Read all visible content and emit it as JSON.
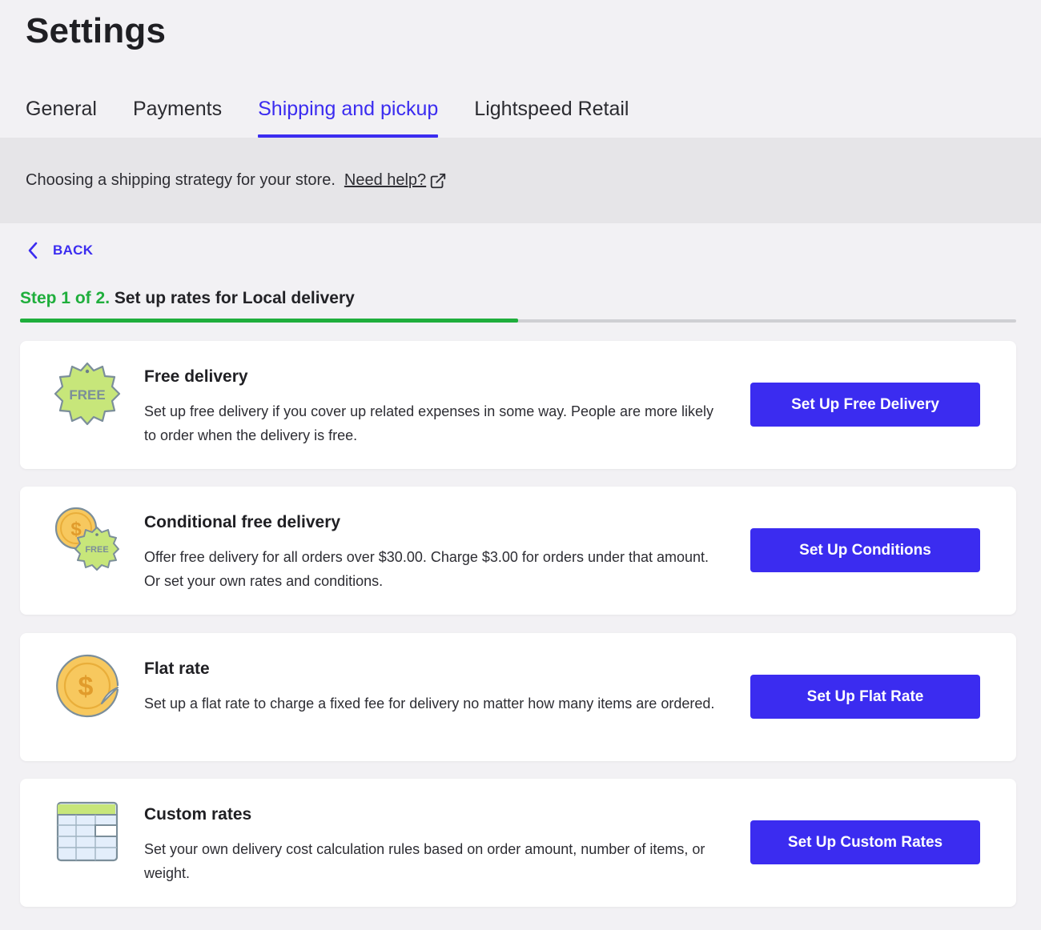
{
  "page": {
    "title": "Settings"
  },
  "tabs": [
    {
      "label": "General",
      "active": false
    },
    {
      "label": "Payments",
      "active": false
    },
    {
      "label": "Shipping and pickup",
      "active": true
    },
    {
      "label": "Lightspeed Retail",
      "active": false
    }
  ],
  "banner": {
    "text": "Choosing a shipping strategy for your store.",
    "help_link": "Need help?",
    "help_icon": "external-link-icon"
  },
  "back": {
    "label": "BACK",
    "icon": "chevron-left-icon"
  },
  "step": {
    "count": "Step 1 of 2.",
    "title": "Set up rates for Local delivery",
    "progress": 0.5
  },
  "options": [
    {
      "icon": "free-badge-icon",
      "icon_text": "FREE",
      "title": "Free delivery",
      "description": "Set up free delivery if you cover up related expenses in some way. People are more likely to order when the delivery is free.",
      "button": "Set Up Free Delivery"
    },
    {
      "icon": "coin-free-badge-icon",
      "icon_text": "FREE",
      "title": "Conditional free delivery",
      "description": "Offer free delivery for all orders over $30.00. Charge $3.00 for orders under that amount. Or set your own rates and conditions.",
      "button": "Set Up Conditions"
    },
    {
      "icon": "dollar-coin-icon",
      "title": "Flat rate",
      "description": "Set up a flat rate to charge a fixed fee for delivery no matter how many items are ordered.",
      "button": "Set Up Flat Rate"
    },
    {
      "icon": "table-grid-icon",
      "title": "Custom rates",
      "description": "Set your own delivery cost calculation rules based on order amount, number of items, or weight.",
      "button": "Set Up Custom Rates"
    }
  ],
  "colors": {
    "accent": "#3b2cf0",
    "success": "#1fae3c",
    "badge_green": "#c7e67a",
    "coin_yellow": "#f7c85e"
  }
}
